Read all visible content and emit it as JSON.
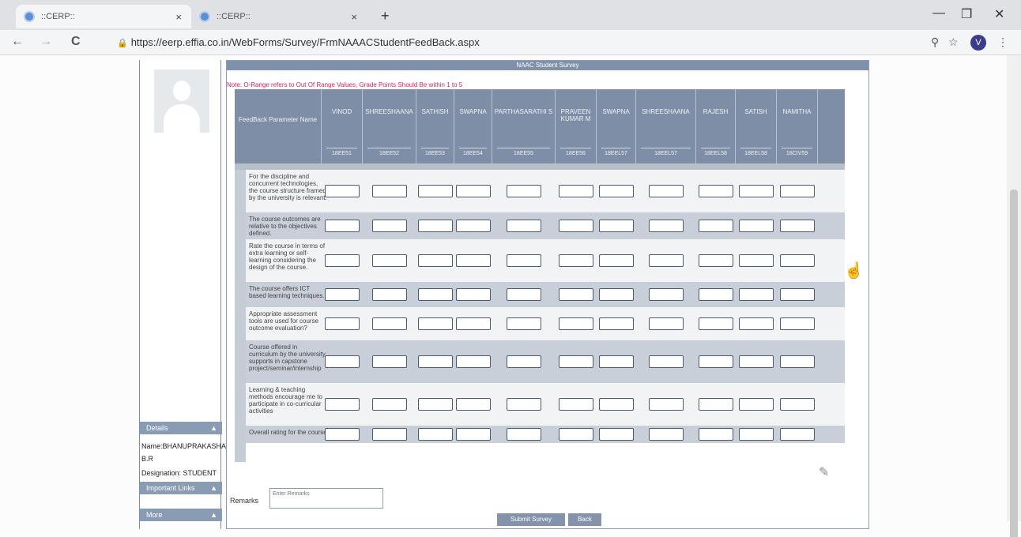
{
  "browser": {
    "tabs": [
      {
        "title": "::CERP::",
        "close": "×"
      },
      {
        "title": "::CERP::",
        "close": "×"
      }
    ],
    "new_tab": "+",
    "window_controls": {
      "minimize": "—",
      "restore": "❐",
      "close": "✕"
    },
    "nav": {
      "back": "←",
      "forward": "→",
      "reload": "C"
    },
    "url": "https://eerp.effia.co.in/WebForms/Survey/FrmNAAACStudentFeedBack.aspx",
    "profile_initial": "V",
    "icons": {
      "zoom": "zoom-icon",
      "bookmark": "star-icon",
      "menu": "kebab-menu-icon"
    }
  },
  "sidebar": {
    "details_header": "Details",
    "name_line": "Name:BHANUPRAKASHA",
    "name_line2": "B.R",
    "designation": "Designation: STUDENT",
    "important_links_header": "Important Links",
    "more_header": "More"
  },
  "survey": {
    "title": "NAAC Student Survey",
    "note": "Note: O-Range refers to Out Of Range Values, Grade Points Should Be within 1 to 5",
    "param_header": "FeedBack Parameter Name",
    "faculty": [
      {
        "name": "VINOD",
        "code": "18EE51"
      },
      {
        "name": "SHREESHAANA",
        "code": "18EE52"
      },
      {
        "name": "SATHISH",
        "code": "18EE53"
      },
      {
        "name": "SWAPNA",
        "code": "18EE54"
      },
      {
        "name": "PARTHASARATHI S",
        "code": "18EE55"
      },
      {
        "name": "PRAVEEN KUMAR M",
        "code": "18EE56"
      },
      {
        "name": "SWAPNA",
        "code": "18EEL57"
      },
      {
        "name": "SHREESHAANA",
        "code": "18EEL57"
      },
      {
        "name": "RAJESH",
        "code": "18EEL58"
      },
      {
        "name": "SATISH",
        "code": "18EEL58"
      },
      {
        "name": "NAMITHA",
        "code": "18CIV59"
      }
    ],
    "questions": [
      "For the discipline and concurrent technologies, the course structure framed by the university is relevant.",
      "The course outcomes are relative to the objectives defined.",
      "Rate the course in terms of extra learning or self-learning considering the design of the course.",
      "The course offers ICT based learning techniques.",
      "Appropriate assessment tools are used for course outcome evaluation?",
      "Course offered in curriculum by the university supports in capstone project/seminar/internship",
      "Learning & teaching methods encourage me to participate in co-curricular activities",
      "Overall rating for the course"
    ],
    "remarks_label": "Remarks",
    "remarks_placeholder": "Enter Remarks",
    "submit_label": "Submit Survey",
    "back_label": "Back"
  },
  "colors": {
    "header_bg": "#7d8ea6",
    "note_text": "#e0245e",
    "row_alt": "#c9cfd8",
    "button_bg": "#8293ab"
  }
}
